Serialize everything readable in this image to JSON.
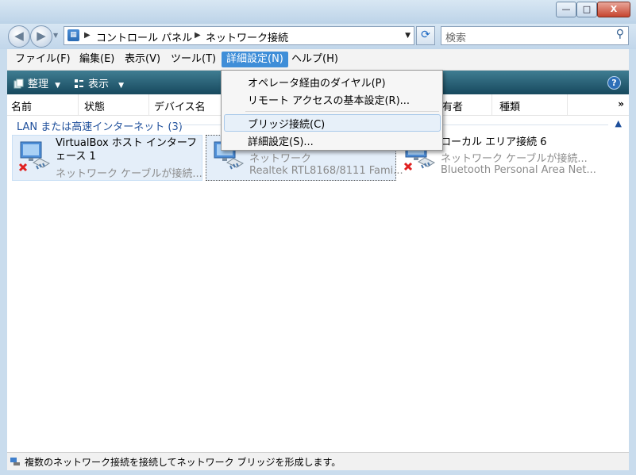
{
  "window": {
    "buttons": {
      "minimize": "—",
      "maximize": "□",
      "close": "X"
    }
  },
  "nav": {
    "back_icon": "back-arrow-icon",
    "forward_icon": "forward-arrow-icon",
    "breadcrumb": [
      "コントロール パネル",
      "ネットワーク接続"
    ],
    "search_placeholder": "検索"
  },
  "menubar": {
    "items": [
      "ファイル(F)",
      "編集(E)",
      "表示(V)",
      "ツール(T)",
      "詳細設定(N)",
      "ヘルプ(H)"
    ],
    "active": "詳細設定(N)"
  },
  "toolbar": {
    "organize": "整理",
    "views": "表示",
    "help": "?"
  },
  "columns": {
    "name": "名前",
    "status": "状態",
    "device": "デバイス名",
    "owner_fragment": "有者",
    "type": "種類",
    "more": "»"
  },
  "group": {
    "title": "LAN または高速インターネット (3)"
  },
  "connections": [
    {
      "name": "VirtualBox ホスト インターフェース 1",
      "status": "ネットワーク ケーブルが接続...",
      "disconnected": true
    },
    {
      "name": "ネットワーク",
      "device": "Realtek RTL8168/8111 Fami...",
      "disconnected": false
    },
    {
      "name": "ローカル エリア接続 6",
      "status": "ネットワーク ケーブルが接続...",
      "device": "Bluetooth Personal Area Net...",
      "disconnected": true
    }
  ],
  "dropdown": {
    "items": [
      "オペレータ経由のダイヤル(P)",
      "リモート アクセスの基本設定(R)...",
      "ブリッジ接続(C)",
      "詳細設定(S)..."
    ],
    "highlighted": "ブリッジ接続(C)"
  },
  "statusbar": {
    "text": "複数のネットワーク接続を接続してネットワーク ブリッジを形成します。"
  },
  "colors": {
    "accent": "#3f8ed8",
    "toolbar": "#17495e",
    "group_text": "#1e4f9b",
    "error_x": "#e02020"
  }
}
